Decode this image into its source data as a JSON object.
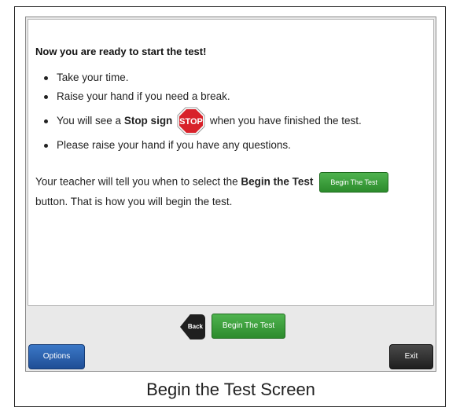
{
  "content": {
    "title": "Now you are ready to start the test!",
    "bullets": [
      "Take your time.",
      "Raise your hand if you need a break.",
      {
        "before": "You will see a ",
        "bold": "Stop sign",
        "after": " when you have finished the test."
      },
      "Please raise your hand if you have any questions."
    ],
    "stop_sign_text": "STOP",
    "teacher_before": "Your teacher will tell you when to select the ",
    "teacher_bold": "Begin the Test",
    "teacher_after": "button. That is how you will begin the test.",
    "inline_button_label": "Begin The Test"
  },
  "footer": {
    "back_label": "Back",
    "begin_label": "Begin The Test",
    "options_label": "Options",
    "exit_label": "Exit"
  },
  "caption": "Begin the Test Screen",
  "colors": {
    "green": "#3a9d3a",
    "blue": "#2b63b0",
    "stop_red": "#d8222a",
    "dark": "#1f1f1f"
  },
  "icons": [
    "stop-sign-icon",
    "back-arrow-icon"
  ]
}
